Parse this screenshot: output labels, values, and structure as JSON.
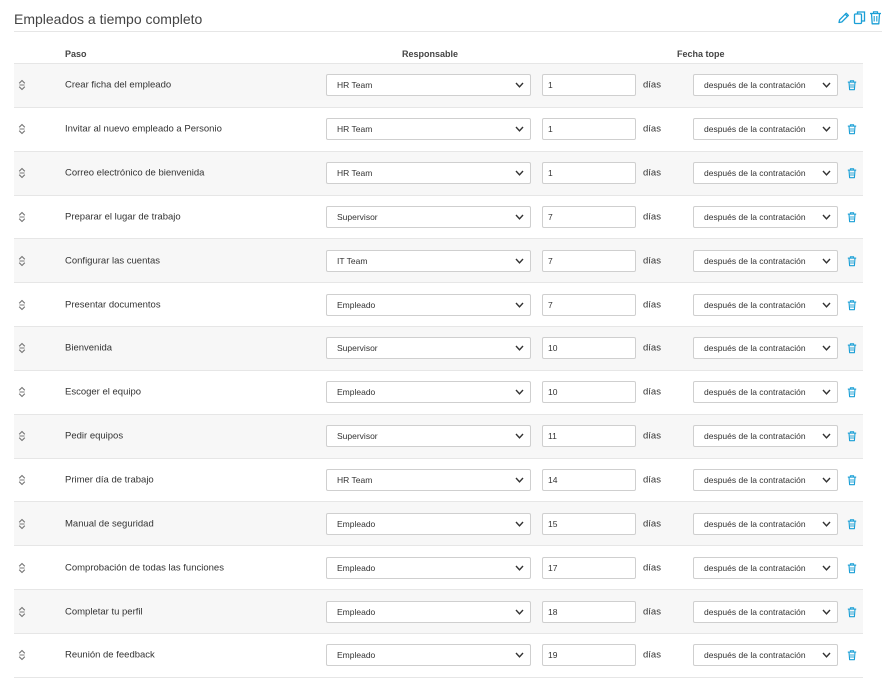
{
  "header": {
    "title": "Empleados a tiempo completo",
    "actions": [
      {
        "name": "edit-button",
        "icon": "pencil-icon"
      },
      {
        "name": "duplicate-button",
        "icon": "copy-icon"
      },
      {
        "name": "delete-template-button",
        "icon": "trash-icon"
      }
    ]
  },
  "columns": {
    "step": "Paso",
    "owner": "Responsable",
    "deadline": "Fecha tope"
  },
  "accent_color": "#1a9fd6",
  "unit_label": "días",
  "rows": [
    {
      "step": "Crear ficha del empleado",
      "owner": "HR Team",
      "days": "1",
      "when": "después de la contratación"
    },
    {
      "step": "Invitar al nuevo empleado a Personio",
      "owner": "HR Team",
      "days": "1",
      "when": "después de la contratación"
    },
    {
      "step": "Correo electrónico de bienvenida",
      "owner": "HR Team",
      "days": "1",
      "when": "después de la contratación"
    },
    {
      "step": "Preparar el lugar de trabajo",
      "owner": "Supervisor",
      "days": "7",
      "when": "después de la contratación"
    },
    {
      "step": "Configurar las cuentas",
      "owner": "IT Team",
      "days": "7",
      "when": "después de la contratación"
    },
    {
      "step": "Presentar documentos",
      "owner": "Empleado",
      "days": "7",
      "when": "después de la contratación"
    },
    {
      "step": "Bienvenida",
      "owner": "Supervisor",
      "days": "10",
      "when": "después de la contratación"
    },
    {
      "step": "Escoger el equipo",
      "owner": "Empleado",
      "days": "10",
      "when": "después de la contratación"
    },
    {
      "step": "Pedir equipos",
      "owner": "Supervisor",
      "days": "11",
      "when": "después de la contratación"
    },
    {
      "step": "Primer día de trabajo",
      "owner": "HR Team",
      "days": "14",
      "when": "después de la contratación"
    },
    {
      "step": "Manual de seguridad",
      "owner": "Empleado",
      "days": "15",
      "when": "después de la contratación"
    },
    {
      "step": "Comprobación de todas las funciones",
      "owner": "Empleado",
      "days": "17",
      "when": "después de la contratación"
    },
    {
      "step": "Completar tu perfil",
      "owner": "Empleado",
      "days": "18",
      "when": "después de la contratación"
    },
    {
      "step": "Reunión de feedback",
      "owner": "Empleado",
      "days": "19",
      "when": "después de la contratación"
    }
  ]
}
